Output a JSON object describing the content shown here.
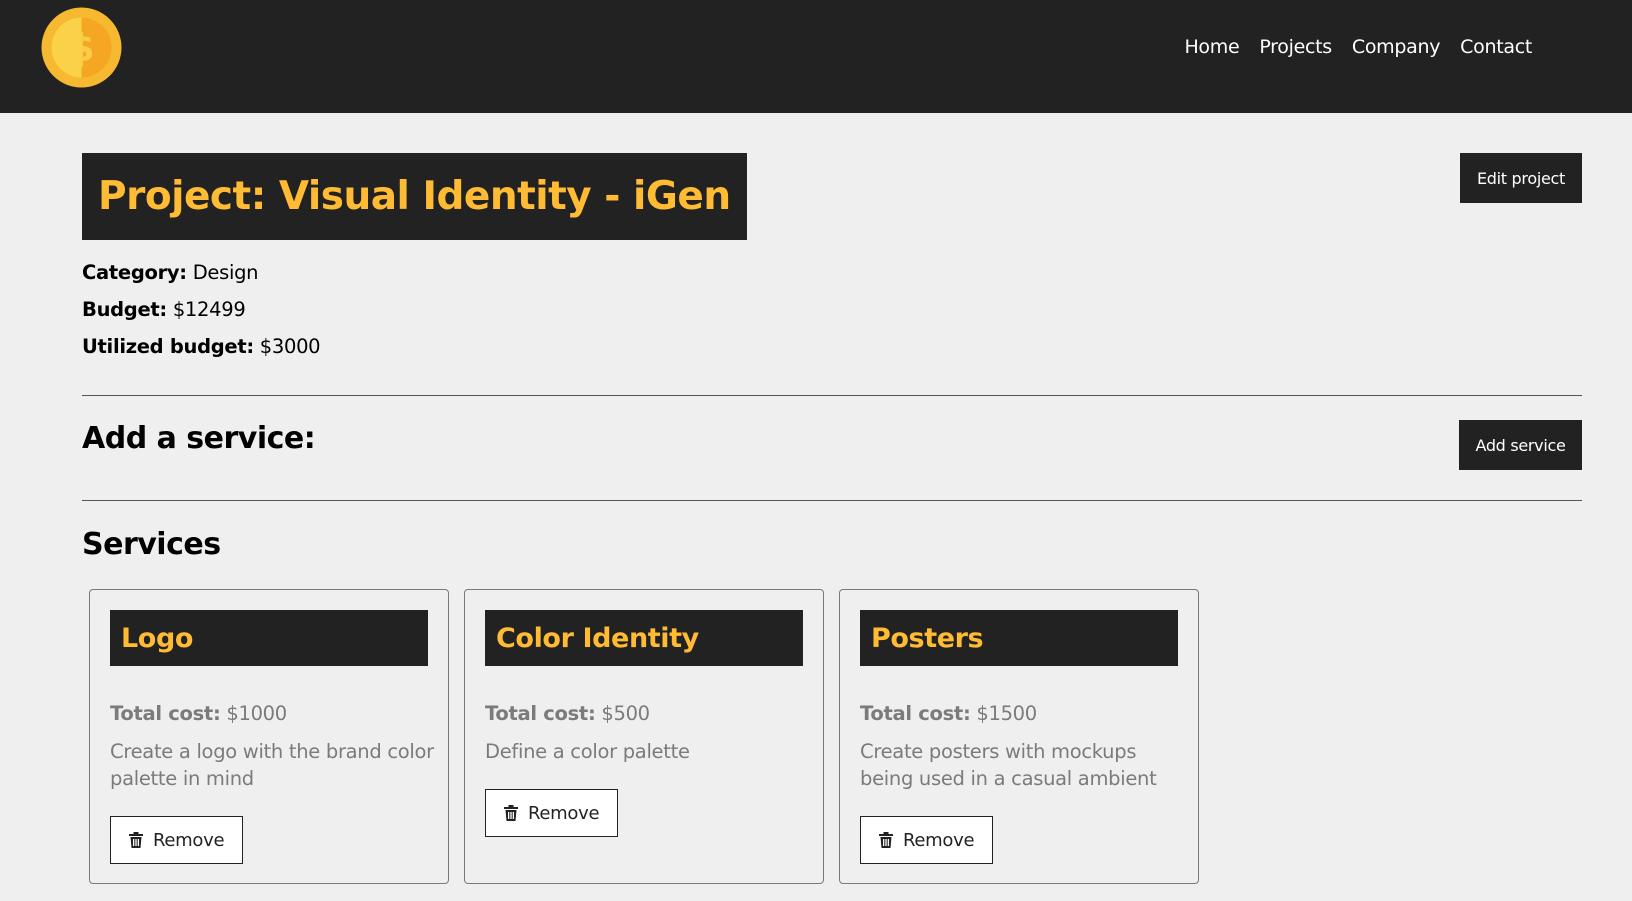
{
  "nav": {
    "logo_icon": "dollar-coin-icon",
    "links": [
      "Home",
      "Projects",
      "Company",
      "Contact"
    ]
  },
  "project": {
    "title": "Project: Visual Identity - iGen",
    "edit_label": "Edit project",
    "category_label": "Category:",
    "category_value": "Design",
    "budget_label": "Budget:",
    "budget_value": "$12499",
    "utilized_label": "Utilized budget:",
    "utilized_value": "$3000"
  },
  "add_service": {
    "heading": "Add a service:",
    "button_label": "Add service"
  },
  "services": {
    "heading": "Services",
    "items": [
      {
        "name": "Logo",
        "cost_label": "Total cost:",
        "cost_value": "$1000",
        "description": "Create a logo with the brand color palette in mind",
        "remove_label": "Remove"
      },
      {
        "name": "Color Identity",
        "cost_label": "Total cost:",
        "cost_value": "$500",
        "description": "Define a color palette",
        "remove_label": "Remove"
      },
      {
        "name": "Posters",
        "cost_label": "Total cost:",
        "cost_value": "$1500",
        "description": "Create posters with mockups being used in a casual ambient",
        "remove_label": "Remove"
      }
    ]
  },
  "colors": {
    "dark": "#222222",
    "accent": "#ffbb33",
    "background": "#efefef",
    "muted_text": "#7b7b7b"
  }
}
